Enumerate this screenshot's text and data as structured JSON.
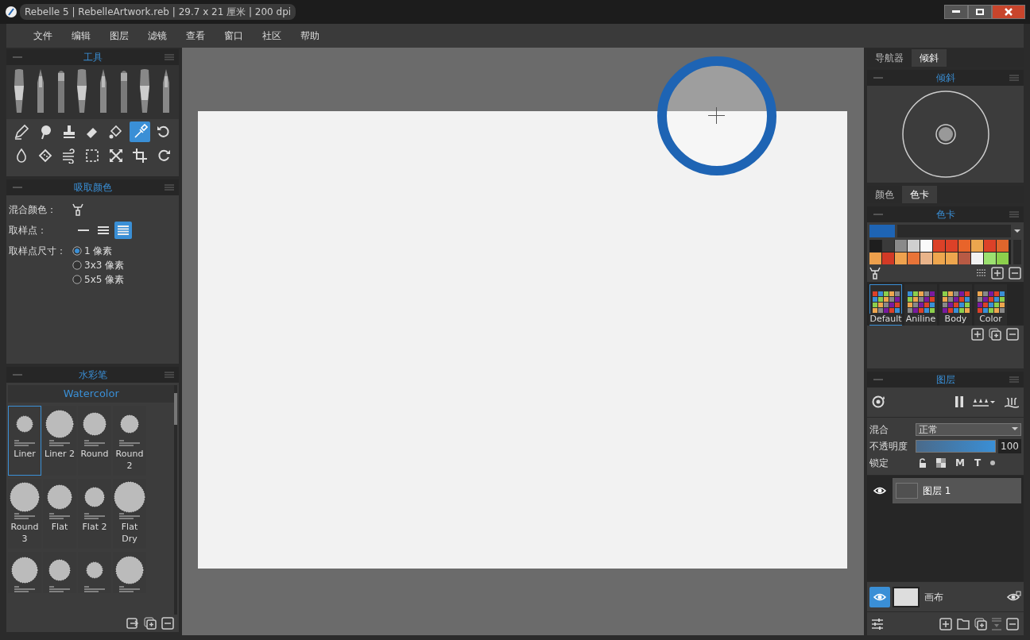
{
  "window": {
    "title": "Rebelle 5 | RebelleArtwork.reb | 29.7 x 21 厘米 | 200 dpi"
  },
  "menu": [
    "文件",
    "编辑",
    "图层",
    "滤镜",
    "查看",
    "窗口",
    "社区",
    "帮助"
  ],
  "tools_panel": {
    "title": "工具",
    "tools": [
      {
        "kind": "pencil",
        "selected": false
      },
      {
        "kind": "blob",
        "selected": false
      },
      {
        "kind": "stamp",
        "selected": false
      },
      {
        "kind": "eraser",
        "selected": false
      },
      {
        "kind": "bucket",
        "selected": false
      },
      {
        "kind": "picker",
        "selected": true
      },
      {
        "kind": "undo",
        "selected": false
      },
      {
        "kind": "drop",
        "selected": false
      },
      {
        "kind": "sponge",
        "selected": false
      },
      {
        "kind": "wind",
        "selected": false
      },
      {
        "kind": "select",
        "selected": false
      },
      {
        "kind": "move",
        "selected": false
      },
      {
        "kind": "crop",
        "selected": false
      },
      {
        "kind": "redo",
        "selected": false
      }
    ]
  },
  "picker_panel": {
    "title": "吸取颜色",
    "mix_label": "混合颜色：",
    "sample_label": "取样点：",
    "sample_modes": [
      {
        "kind": "single",
        "selected": false
      },
      {
        "kind": "triple",
        "selected": false
      },
      {
        "kind": "many",
        "selected": true
      }
    ],
    "size_label": "取样点尺寸：",
    "sizes": [
      {
        "label": "1 像素",
        "selected": true
      },
      {
        "label": "3x3 像素",
        "selected": false
      },
      {
        "label": "5x5 像素",
        "selected": false
      }
    ]
  },
  "brush_panel": {
    "title": "水彩笔",
    "set": "Watercolor",
    "brushes": [
      {
        "label": "Liner",
        "selected": true
      },
      {
        "label": "Liner 2",
        "selected": false
      },
      {
        "label": "Round",
        "selected": false
      },
      {
        "label": "Round 2",
        "selected": false
      },
      {
        "label": "Round 3",
        "selected": false
      },
      {
        "label": "Flat",
        "selected": false
      },
      {
        "label": "Flat 2",
        "selected": false
      },
      {
        "label": "Flat Dry",
        "selected": false
      },
      {
        "selected": false
      },
      {
        "selected": false
      },
      {
        "selected": false
      },
      {
        "selected": false
      }
    ]
  },
  "right_tabs": [
    {
      "label": "导航器",
      "selected": false
    },
    {
      "label": "倾斜",
      "selected": true
    }
  ],
  "tilt_panel": {
    "title": "倾斜"
  },
  "color_tabs": [
    {
      "label": "颜色",
      "selected": false
    },
    {
      "label": "色卡",
      "selected": true
    }
  ],
  "swatch_panel": {
    "title": "色卡",
    "swatches": [
      {
        "color": "#1e1e1e"
      },
      {
        "color": "#3a3a3a"
      },
      {
        "color": "#8a8a8a"
      },
      {
        "color": "#cfcfcf"
      },
      {
        "color": "#fafafa"
      },
      {
        "color": "#dc4128"
      },
      {
        "color": "#dc4128"
      },
      {
        "color": "#e8642a"
      },
      {
        "color": "#eca64e"
      },
      {
        "color": "#dc4128"
      },
      {
        "color": "#e0662c"
      },
      {
        "color": "#eea04c"
      },
      {
        "color": "#d23a26"
      },
      {
        "color": "#efa24e"
      },
      {
        "color": "#e87438"
      },
      {
        "color": "#e9b48a"
      },
      {
        "color": "#eea64e"
      },
      {
        "color": "#eea64e"
      },
      {
        "color": "#b85a44"
      },
      {
        "color": "#f2f2f2"
      },
      {
        "color": "#9ce070"
      },
      {
        "color": "#8ccf4c"
      }
    ],
    "palettes": [
      {
        "label": "Default",
        "selected": true
      },
      {
        "label": "Aniline",
        "selected": false
      },
      {
        "label": "Body",
        "selected": false
      },
      {
        "label": "Color",
        "selected": false
      }
    ]
  },
  "layers_panel": {
    "title": "图层",
    "blend_label": "混合",
    "blend_value": "正常",
    "opacity_label": "不透明度",
    "opacity": {
      "level": 1.0
    },
    "opacity_value": "100",
    "lock_label": "锁定",
    "lock_letters": [
      "M",
      "T"
    ],
    "layers": [
      {
        "name": "图层 1",
        "visible": true,
        "selected": true
      }
    ],
    "canvas_layer": {
      "name": "画布",
      "visible": true
    }
  }
}
